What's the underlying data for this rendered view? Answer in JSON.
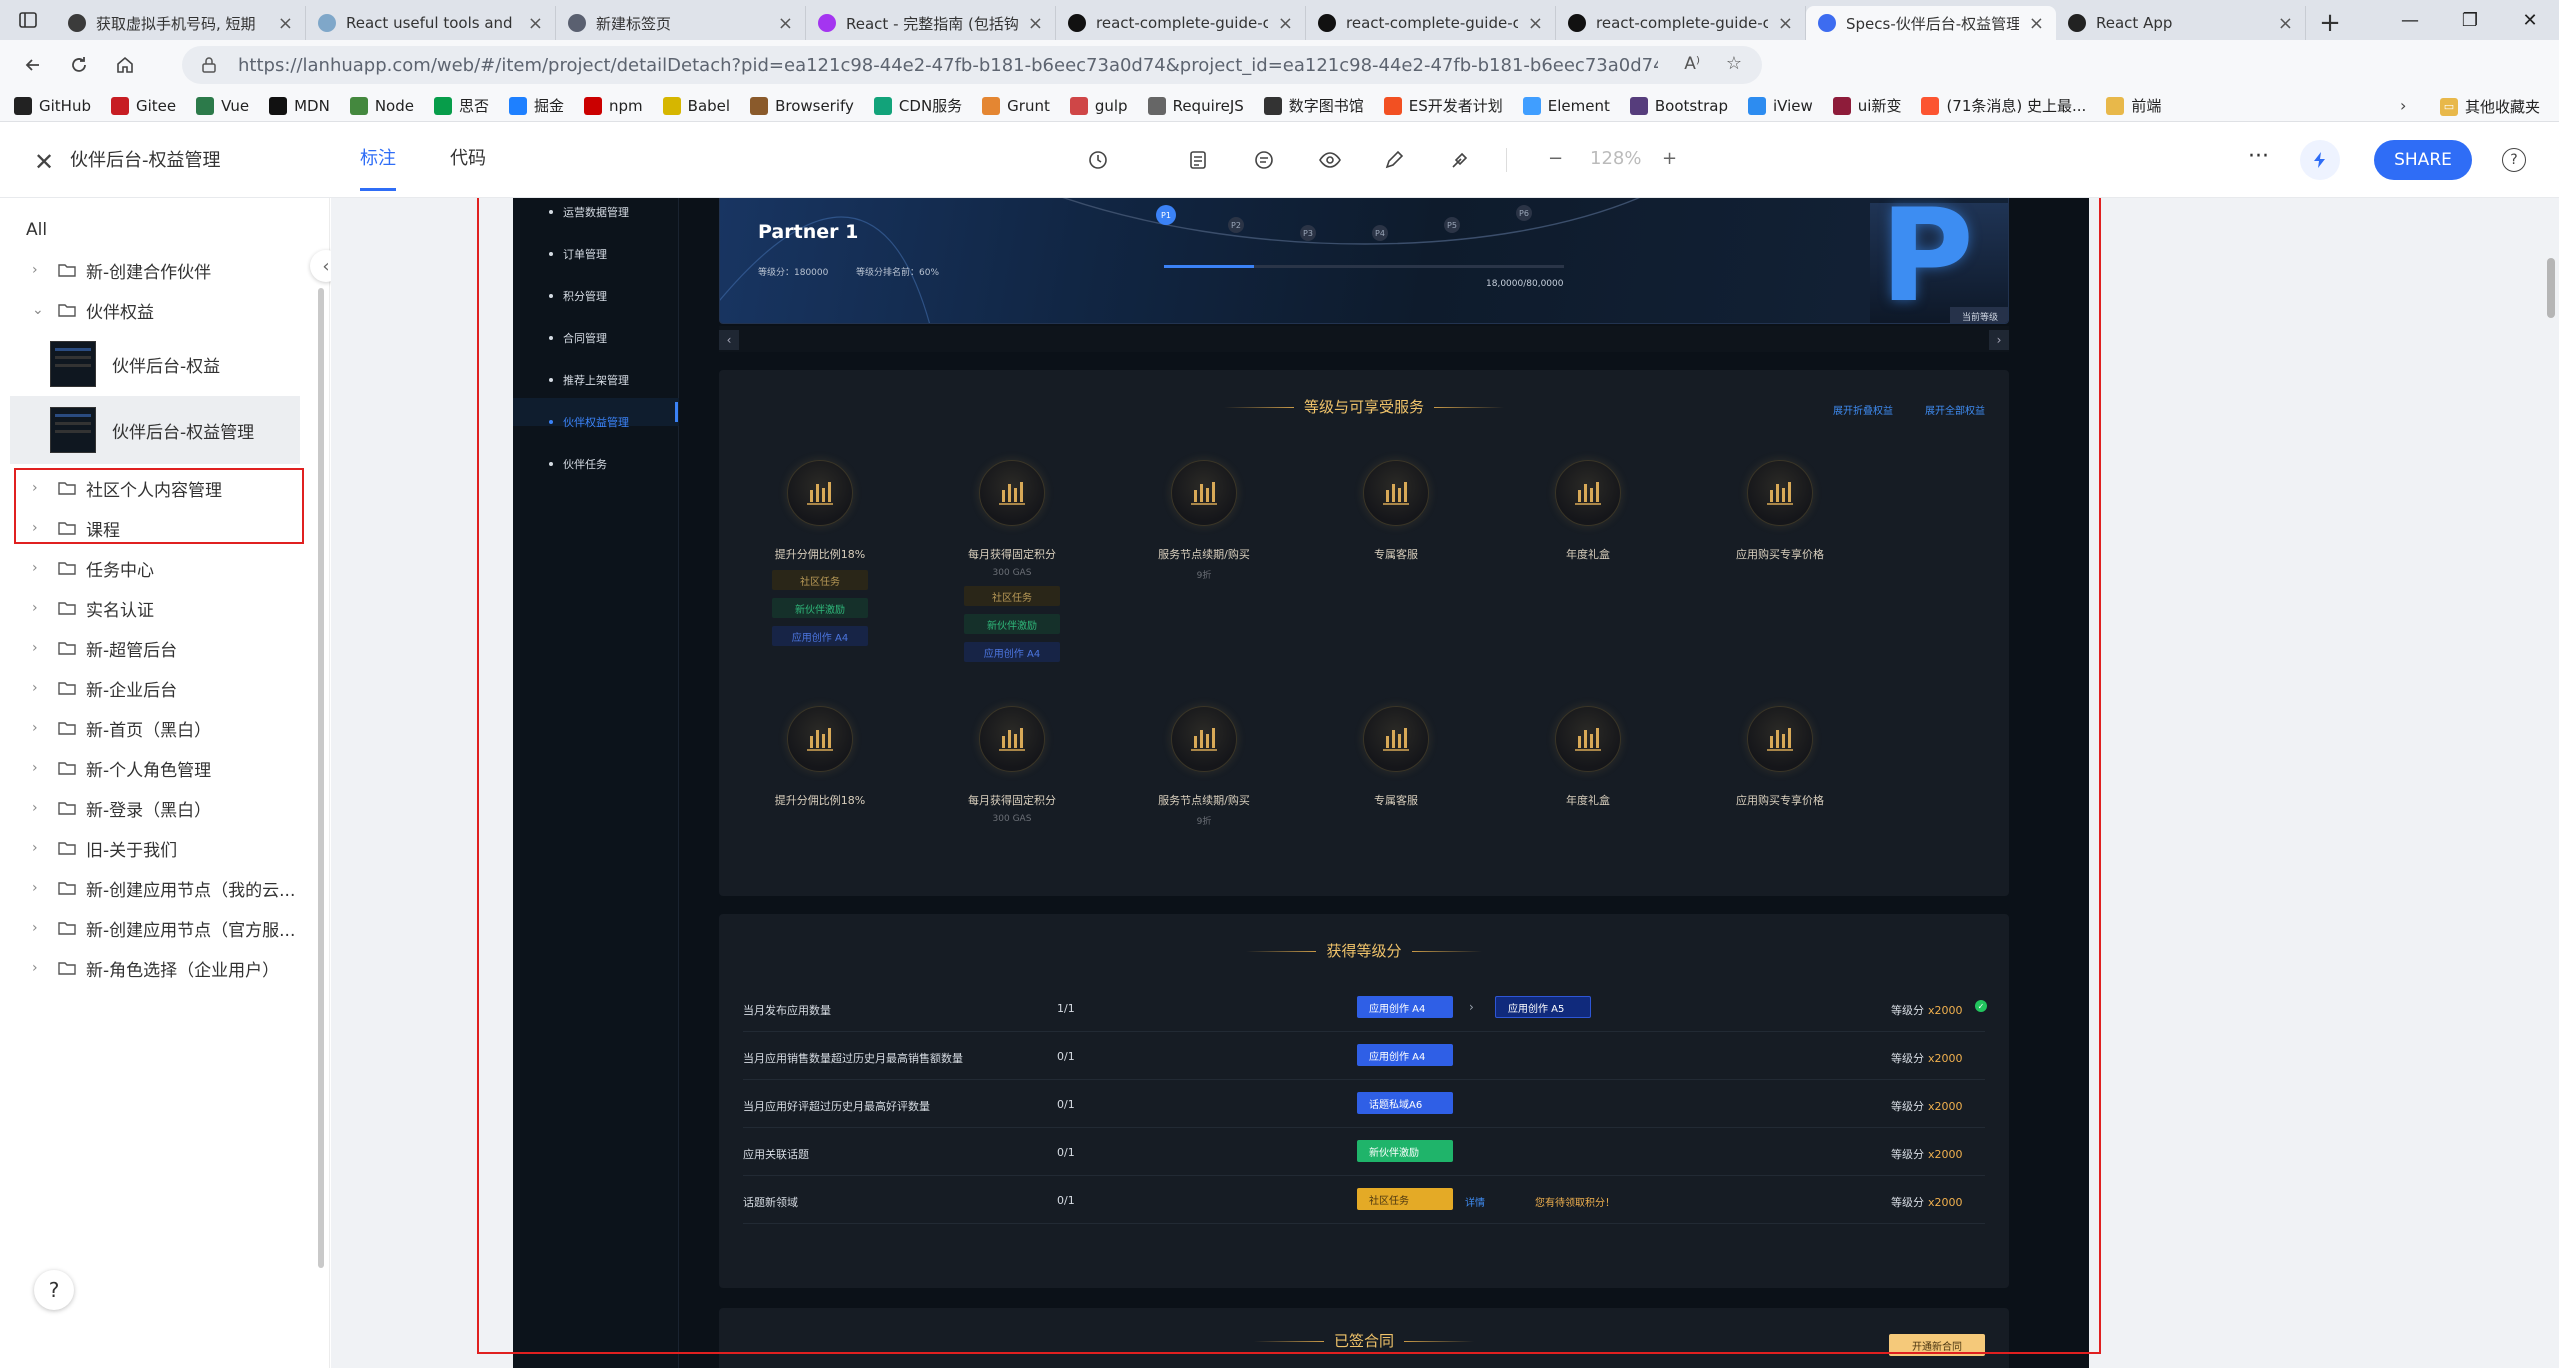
{
  "browser": {
    "tabs": [
      {
        "title": "获取虚拟手机号码, 短期",
        "color": "#3b3b3b"
      },
      {
        "title": "React useful tools and lib",
        "color": "#7fa7c9"
      },
      {
        "title": "新建标签页",
        "color": "#5a6070"
      },
      {
        "title": "React - 完整指南 (包括钩",
        "color": "#a435f0"
      },
      {
        "title": "react-complete-guide-co",
        "color": "#111"
      },
      {
        "title": "react-complete-guide-co",
        "color": "#111"
      },
      {
        "title": "react-complete-guide-co",
        "color": "#111"
      },
      {
        "title": "Specs-伙伴后台-权益管理",
        "color": "#3d6cf0"
      },
      {
        "title": "React App",
        "color": "#222"
      }
    ],
    "active_tab": 7,
    "url": "https://lanhuapp.com/web/#/item/project/detailDetach?pid=ea121c98-44e2-47fb-b181-b6eec73a0d74&project_id=ea121c98-44e2-47fb-b181-b6eec73a0d74&image_id=16ee017e-4...",
    "bookmarks": [
      {
        "label": "GitHub",
        "color": "#222"
      },
      {
        "label": "Gitee",
        "color": "#c71d23"
      },
      {
        "label": "Vue",
        "color": "#2c7a4a"
      },
      {
        "label": "MDN",
        "color": "#111"
      },
      {
        "label": "Node",
        "color": "#44883e"
      },
      {
        "label": "思否",
        "color": "#079d4a"
      },
      {
        "label": "掘金",
        "color": "#1e80ff"
      },
      {
        "label": "npm",
        "color": "#cb0000"
      },
      {
        "label": "Babel",
        "color": "#d6b600"
      },
      {
        "label": "Browserify",
        "color": "#8a5a2b"
      },
      {
        "label": "CDN服务",
        "color": "#12a37a"
      },
      {
        "label": "Grunt",
        "color": "#e48632"
      },
      {
        "label": "gulp",
        "color": "#cf4647"
      },
      {
        "label": "RequireJS",
        "color": "#666"
      },
      {
        "label": "数字图书馆",
        "color": "#333"
      },
      {
        "label": "ES开发者计划",
        "color": "#f25022"
      },
      {
        "label": "Element",
        "color": "#409eff"
      },
      {
        "label": "Bootstrap",
        "color": "#563d7c"
      },
      {
        "label": "iView",
        "color": "#2d8cf0"
      },
      {
        "label": "ui新变",
        "color": "#8e1c3a"
      },
      {
        "label": "(71条消息) 史上最...",
        "color": "#fc5531"
      },
      {
        "label": "前端",
        "color": "#e8b84a"
      }
    ],
    "other_bookmarks": "其他收藏夹"
  },
  "header": {
    "title": "伙伴后台-权益管理",
    "tab_annotate": "标注",
    "tab_code": "代码",
    "zoom": "128%",
    "share": "SHARE"
  },
  "sidebar": {
    "all": "All",
    "items": [
      {
        "label": "新-创建合作伙伴"
      },
      {
        "label": "伙伴权益"
      },
      {
        "label": "社区个人内容管理"
      },
      {
        "label": "课程"
      },
      {
        "label": "任务中心"
      },
      {
        "label": "实名认证"
      },
      {
        "label": "新-超管后台"
      },
      {
        "label": "新-企业后台"
      },
      {
        "label": "新-首页（黑白）"
      },
      {
        "label": "新-个人角色管理"
      },
      {
        "label": "新-登录（黑白）"
      },
      {
        "label": "旧-关于我们"
      },
      {
        "label": "新-创建应用节点（我的云..."
      },
      {
        "label": "新-创建应用节点（官方服..."
      },
      {
        "label": "新-角色选择（企业用户）"
      }
    ],
    "pages": [
      {
        "label": "伙伴后台-权益"
      },
      {
        "label": "伙伴后台-权益管理"
      }
    ]
  },
  "design": {
    "menu": [
      "运营数据管理",
      "订单管理",
      "积分管理",
      "合同管理",
      "推荐上架管理",
      "伙伴权益管理",
      "伙伴任务"
    ],
    "active_menu": 5,
    "partner": {
      "name": "Partner 1",
      "level_points": "等级分：180000",
      "rank": "等级分排名前：60%",
      "progress_text": "18,0000/80,0000",
      "progress": 0.225,
      "levels": [
        "P1",
        "P2",
        "P3",
        "P4",
        "P5",
        "P6"
      ],
      "badge_letter": "P",
      "current_level": "当前等级"
    },
    "benefits_title": "等级与可享受服务",
    "expand_folded": "展开折叠权益",
    "expand_all": "展开全部权益",
    "benefits": [
      {
        "name": "提升分佣比例18%",
        "sub": "",
        "tags": [
          "社区任务",
          "新伙伴激励",
          "应用创作 A4"
        ]
      },
      {
        "name": "每月获得固定积分",
        "sub": "300 GAS",
        "tags": [
          "社区任务",
          "新伙伴激励",
          "应用创作 A4"
        ]
      },
      {
        "name": "服务节点续期/购买",
        "sub": "9折",
        "tags": []
      },
      {
        "name": "专属客服",
        "sub": "",
        "tags": []
      },
      {
        "name": "年度礼盒",
        "sub": "",
        "tags": []
      },
      {
        "name": "应用购买专享价格",
        "sub": "",
        "tags": []
      },
      {
        "name": "提升分佣比例18%",
        "sub": "",
        "tags": []
      },
      {
        "name": "每月获得固定积分",
        "sub": "300 GAS",
        "tags": []
      },
      {
        "name": "服务节点续期/购买",
        "sub": "9折",
        "tags": []
      },
      {
        "name": "专属客服",
        "sub": "",
        "tags": []
      },
      {
        "name": "年度礼盒",
        "sub": "",
        "tags": []
      },
      {
        "name": "应用购买专享价格",
        "sub": "",
        "tags": []
      }
    ],
    "points_title": "获得等级分",
    "points_rows": [
      {
        "task": "当月发布应用数量",
        "progress": "1/1",
        "tag": "应用创作 A4",
        "tag_style": "blue",
        "next": "应用创作 A5",
        "extra": "",
        "pts_label": "等级分",
        "pts": "x2000",
        "done": true
      },
      {
        "task": "当月应用销售数量超过历史月最高销售额数量",
        "progress": "0/1",
        "tag": "应用创作 A4",
        "tag_style": "blue",
        "next": "",
        "extra": "",
        "pts_label": "等级分",
        "pts": "x2000",
        "done": false
      },
      {
        "task": "当月应用好评超过历史月最高好评数量",
        "progress": "0/1",
        "tag": "话题私域A6",
        "tag_style": "blue",
        "next": "",
        "extra": "",
        "pts_label": "等级分",
        "pts": "x2000",
        "done": false
      },
      {
        "task": "应用关联话题",
        "progress": "0/1",
        "tag": "新伙伴激励",
        "tag_style": "green",
        "next": "",
        "extra": "",
        "pts_label": "等级分",
        "pts": "x2000",
        "done": false
      },
      {
        "task": "话题新领域",
        "progress": "0/1",
        "tag": "社区任务",
        "tag_style": "gold",
        "next": "",
        "detail": "详情",
        "extra": "您有待领取积分！",
        "pts_label": "等级分",
        "pts": "x2000",
        "done": false
      }
    ],
    "contract_title": "已签合同",
    "contract_btn": "开通新合同"
  }
}
